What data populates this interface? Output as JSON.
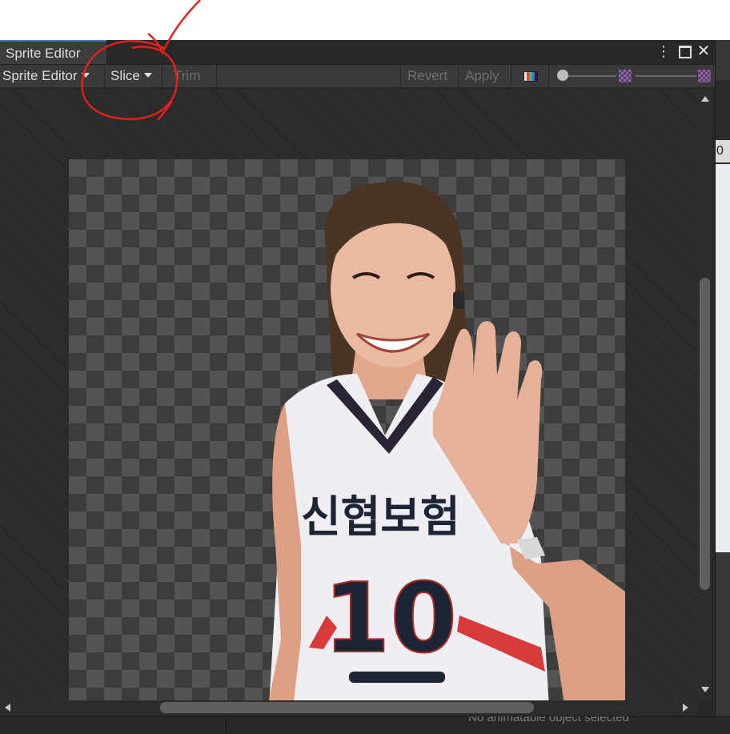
{
  "window": {
    "tab_title": "Sprite Editor",
    "menu_label": "⋮",
    "close_label": "✕"
  },
  "toolbar": {
    "mode_label": "Sprite Editor",
    "slice_label": "Slice",
    "trim_label": "Trim",
    "revert_label": "Revert",
    "apply_label": "Apply"
  },
  "zoom_slider": {
    "value": 0.0
  },
  "mip_slider": {
    "value": 1.0
  },
  "sprite": {
    "jersey_text": "신협보험",
    "jersey_number": "10",
    "subject": "volleyball player waving"
  },
  "background": {
    "right_panel_digit": "0",
    "status_text": "No animatable object selected"
  },
  "colors": {
    "window_bg": "#282828",
    "toolbar_bg": "#3a3a3a",
    "tab_accent": "#3a79bb",
    "annotation": "#e0211d"
  }
}
